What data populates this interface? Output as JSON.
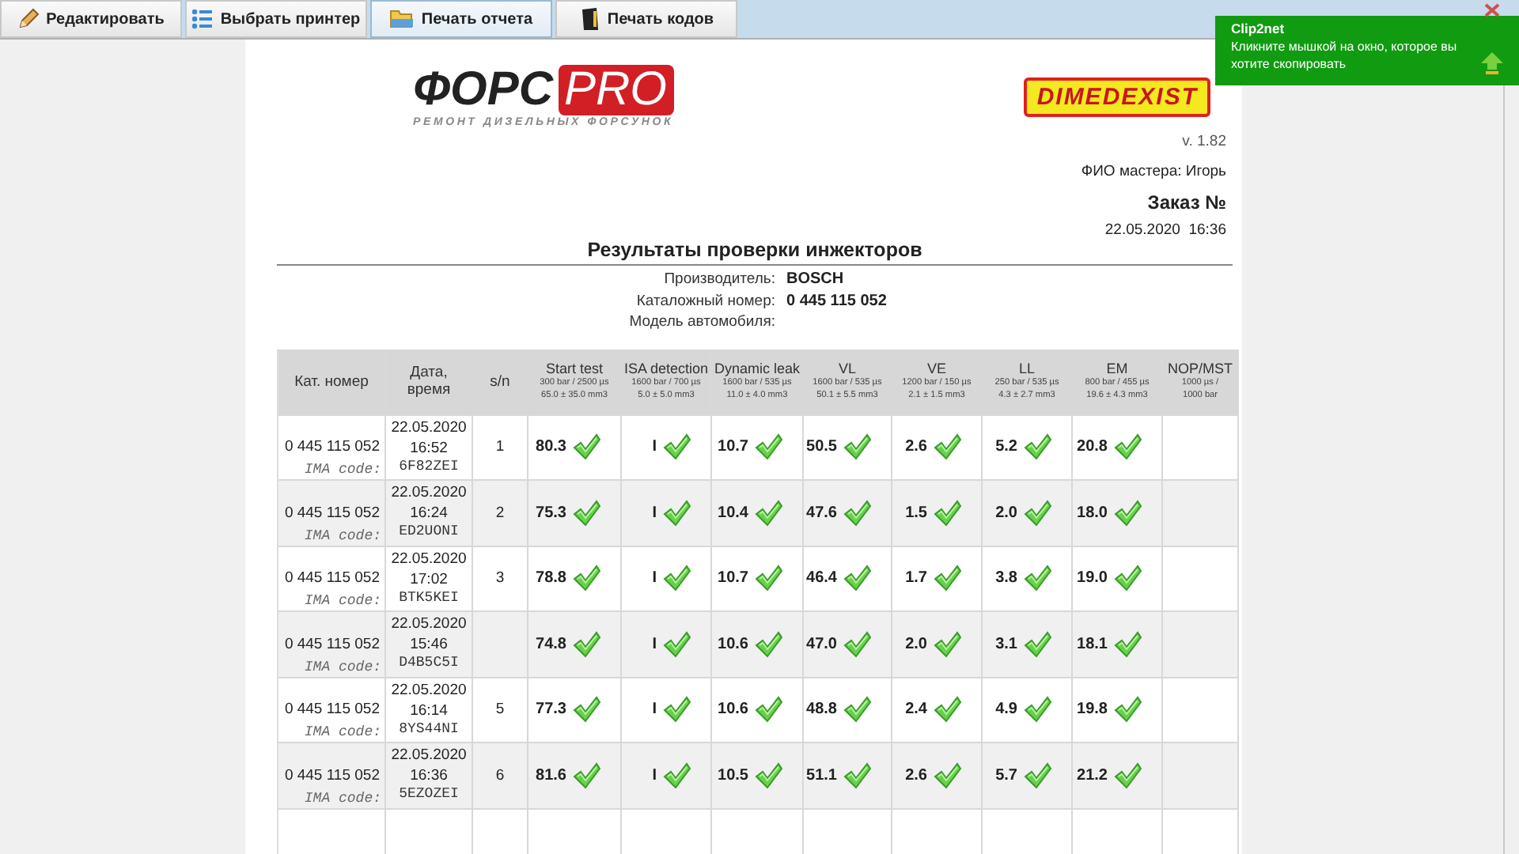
{
  "toolbar": {
    "buttons": [
      {
        "label": "Редактировать",
        "kind": "edit",
        "selected": false
      },
      {
        "label": "Выбрать принтер",
        "kind": "printer",
        "selected": false
      },
      {
        "label": "Печать отчета",
        "kind": "report",
        "selected": true
      },
      {
        "label": "Печать кодов",
        "kind": "codes",
        "selected": false
      }
    ]
  },
  "notification": {
    "title": "Clip2net",
    "message": "Кликните мышкой на окно, которое вы хотите скопировать"
  },
  "report": {
    "logo": {
      "name": "ФОРС",
      "badge": "PRO",
      "tagline": "РЕМОНТ ДИЗЕЛЬНЫХ ФОРСУНОК"
    },
    "partner_logo": "DIMEDEXIST",
    "version": "v. 1.82",
    "master": "ФИО мастера: Игорь",
    "order_title": "Заказ №",
    "order_date": "22.05.2020  16:36",
    "title": "Результаты проверки инжекторов",
    "info": [
      {
        "label": "Производитель:",
        "value": "BOSCH"
      },
      {
        "label": "Каталожный номер:",
        "value": "0 445 115 052"
      },
      {
        "label": "Модель автомобиля:"
      }
    ],
    "table": {
      "columns": [
        {
          "title": "Кат. номер"
        },
        {
          "title": "Дата, время"
        },
        {
          "title": "s/n"
        },
        {
          "title": "Start test",
          "spec": [
            "300 bar / 2500 µs",
            "65.0 ± 35.0 mm3"
          ]
        },
        {
          "title": "ISA detection",
          "spec": [
            "1600 bar / 700 µs",
            "5.0 ± 5.0 mm3"
          ]
        },
        {
          "title": "Dynamic leak",
          "spec": [
            "1600 bar / 535 µs",
            "11.0 ± 4.0 mm3"
          ]
        },
        {
          "title": "VL",
          "spec": [
            "1600 bar / 535 µs",
            "50.1 ± 5.5 mm3"
          ]
        },
        {
          "title": "VE",
          "spec": [
            "1200 bar / 150 µs",
            "2.1 ± 1.5 mm3"
          ]
        },
        {
          "title": "LL",
          "spec": [
            "250 bar / 535 µs",
            "4.3 ± 2.7 mm3"
          ]
        },
        {
          "title": "EM",
          "spec": [
            "800 bar / 455 µs",
            "19.6 ± 4.3 mm3"
          ]
        },
        {
          "title": "NOP/MST",
          "spec": [
            "1000 µs /",
            "1000 bar"
          ]
        }
      ],
      "rows": [
        {
          "part": "0 445 115 052",
          "date": "22.05.2020",
          "time": "16:52",
          "ima_label": "IMA code:",
          "ima_code": "6F82ZEI",
          "sn": "1",
          "results": [
            {
              "value": "80.3",
              "pass": true
            },
            {
              "value": "I",
              "pass": true
            },
            {
              "value": "10.7",
              "pass": true
            },
            {
              "value": "50.5",
              "pass": true
            },
            {
              "value": "2.6",
              "pass": true
            },
            {
              "value": "5.2",
              "pass": true
            },
            {
              "value": "20.8",
              "pass": true
            }
          ]
        },
        {
          "part": "0 445 115 052",
          "date": "22.05.2020",
          "time": "16:24",
          "ima_label": "IMA code:",
          "ima_code": "ED2UONI",
          "sn": "2",
          "results": [
            {
              "value": "75.3",
              "pass": true
            },
            {
              "value": "I",
              "pass": true
            },
            {
              "value": "10.4",
              "pass": true
            },
            {
              "value": "47.6",
              "pass": true
            },
            {
              "value": "1.5",
              "pass": true
            },
            {
              "value": "2.0",
              "pass": true
            },
            {
              "value": "18.0",
              "pass": true
            }
          ]
        },
        {
          "part": "0 445 115 052",
          "date": "22.05.2020",
          "time": "17:02",
          "ima_label": "IMA code:",
          "ima_code": "BTK5KEI",
          "sn": "3",
          "results": [
            {
              "value": "78.8",
              "pass": true
            },
            {
              "value": "I",
              "pass": true
            },
            {
              "value": "10.7",
              "pass": true
            },
            {
              "value": "46.4",
              "pass": true
            },
            {
              "value": "1.7",
              "pass": true
            },
            {
              "value": "3.8",
              "pass": true
            },
            {
              "value": "19.0",
              "pass": true
            }
          ]
        },
        {
          "part": "0 445 115 052",
          "date": "22.05.2020",
          "time": "15:46",
          "ima_label": "IMA code:",
          "ima_code": "D4B5C5I",
          "results": [
            {
              "value": "74.8",
              "pass": true
            },
            {
              "value": "I",
              "pass": true
            },
            {
              "value": "10.6",
              "pass": true
            },
            {
              "value": "47.0",
              "pass": true
            },
            {
              "value": "2.0",
              "pass": true
            },
            {
              "value": "3.1",
              "pass": true
            },
            {
              "value": "18.1",
              "pass": true
            }
          ]
        },
        {
          "part": "0 445 115 052",
          "date": "22.05.2020",
          "time": "16:14",
          "ima_label": "IMA code:",
          "ima_code": "8YS44NI",
          "sn": "5",
          "results": [
            {
              "value": "77.3",
              "pass": true
            },
            {
              "value": "I",
              "pass": true
            },
            {
              "value": "10.6",
              "pass": true
            },
            {
              "value": "48.8",
              "pass": true
            },
            {
              "value": "2.4",
              "pass": true
            },
            {
              "value": "4.9",
              "pass": true
            },
            {
              "value": "19.8",
              "pass": true
            }
          ]
        },
        {
          "part": "0 445 115 052",
          "date": "22.05.2020",
          "time": "16:36",
          "ima_label": "IMA code:",
          "ima_code": "5EZOZEI",
          "sn": "6",
          "results": [
            {
              "value": "81.6",
              "pass": true
            },
            {
              "value": "I",
              "pass": true
            },
            {
              "value": "10.5",
              "pass": true
            },
            {
              "value": "51.1",
              "pass": true
            },
            {
              "value": "2.6",
              "pass": true
            },
            {
              "value": "5.7",
              "pass": true
            },
            {
              "value": "21.2",
              "pass": true
            }
          ]
        }
      ]
    }
  }
}
